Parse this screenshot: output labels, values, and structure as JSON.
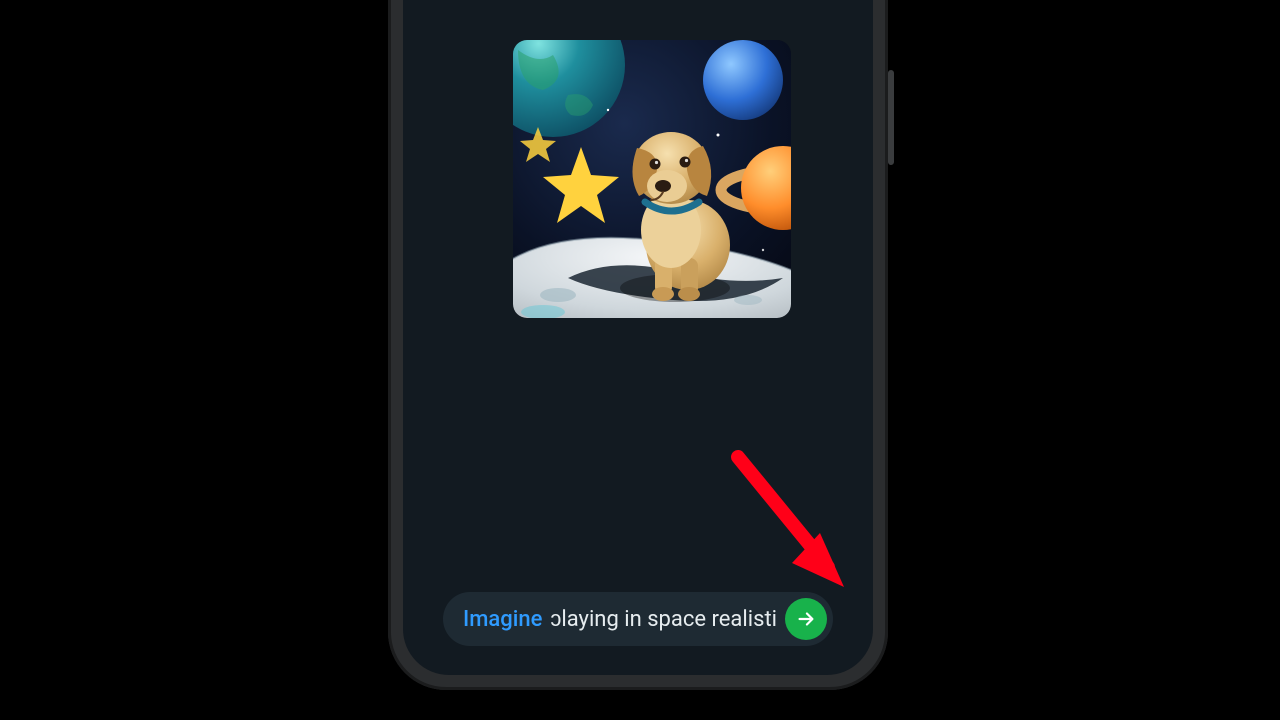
{
  "image": {
    "alt": "AI-generated image of a golden labrador puppy sitting on a moon-like surface with planets and stars in a space background",
    "subject": "golden labrador puppy",
    "scene": "space with planets, stars, moon surface"
  },
  "input": {
    "command_prefix": "Imagine",
    "visible_text": "ɔlaying in space realistic"
  },
  "annotation": {
    "type": "red arrow pointing to send button"
  },
  "icons": {
    "send": "arrow-right"
  },
  "colors": {
    "send_button": "#18b24b",
    "command_link": "#2f9bff",
    "annotation_arrow": "#ff0018"
  }
}
